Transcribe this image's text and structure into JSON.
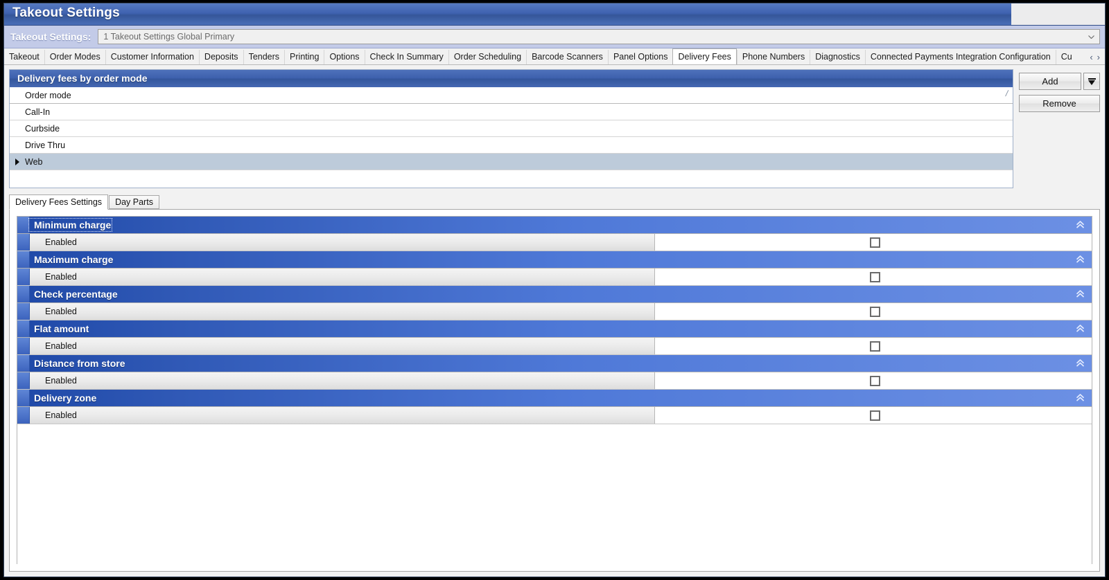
{
  "window": {
    "title": "Takeout Settings"
  },
  "selector": {
    "label": "Takeout Settings:",
    "value": "1 Takeout Settings Global Primary",
    "placeholder": "1 Takeout Settings Global Primary"
  },
  "main_tabs": [
    {
      "label": "Takeout",
      "active": false
    },
    {
      "label": "Order Modes",
      "active": false
    },
    {
      "label": "Customer Information",
      "active": false
    },
    {
      "label": "Deposits",
      "active": false
    },
    {
      "label": "Tenders",
      "active": false
    },
    {
      "label": "Printing",
      "active": false
    },
    {
      "label": "Options",
      "active": false
    },
    {
      "label": "Check In Summary",
      "active": false
    },
    {
      "label": "Order Scheduling",
      "active": false
    },
    {
      "label": "Barcode Scanners",
      "active": false
    },
    {
      "label": "Panel Options",
      "active": false
    },
    {
      "label": "Delivery Fees",
      "active": true
    },
    {
      "label": "Phone Numbers",
      "active": false
    },
    {
      "label": "Diagnostics",
      "active": false
    },
    {
      "label": "Connected Payments Integration Configuration",
      "active": false
    },
    {
      "label": "Cu",
      "active": false
    }
  ],
  "tab_nav": {
    "prev": "‹",
    "next": "›"
  },
  "grid": {
    "caption": "Delivery fees by order mode",
    "column_header": "Order mode",
    "sort_mark": "/",
    "rows": [
      {
        "label": "Call-In",
        "selected": false
      },
      {
        "label": "Curbside",
        "selected": false
      },
      {
        "label": "Drive Thru",
        "selected": false
      },
      {
        "label": "Web",
        "selected": true
      }
    ]
  },
  "side_buttons": {
    "add_label": "Add",
    "add_dropdown_icon": "dropdown-arrow-icon",
    "remove_label": "Remove"
  },
  "inner_tabs": [
    {
      "label": "Delivery Fees Settings",
      "active": true
    },
    {
      "label": "Day Parts",
      "active": false
    }
  ],
  "sections": [
    {
      "title": "Minimum charge",
      "focused": true,
      "collapse_icon": "collapse-chevron-icon",
      "rows": [
        {
          "label": "Enabled",
          "checked": false
        }
      ]
    },
    {
      "title": "Maximum charge",
      "focused": false,
      "collapse_icon": "collapse-chevron-icon",
      "rows": [
        {
          "label": "Enabled",
          "checked": false
        }
      ]
    },
    {
      "title": "Check percentage",
      "focused": false,
      "collapse_icon": "collapse-chevron-icon",
      "rows": [
        {
          "label": "Enabled",
          "checked": false
        }
      ]
    },
    {
      "title": "Flat amount",
      "focused": false,
      "collapse_icon": "collapse-chevron-icon",
      "rows": [
        {
          "label": "Enabled",
          "checked": false
        }
      ]
    },
    {
      "title": "Distance from store",
      "focused": false,
      "collapse_icon": "collapse-chevron-icon",
      "rows": [
        {
          "label": "Enabled",
          "checked": false
        }
      ]
    },
    {
      "title": "Delivery zone",
      "focused": false,
      "collapse_icon": "collapse-chevron-icon",
      "rows": [
        {
          "label": "Enabled",
          "checked": false
        }
      ]
    }
  ],
  "colors": {
    "title_blue": "#3f62b0",
    "selector_bar": "#c3cbe8",
    "section_header_left": "#1f49a8",
    "section_header_right": "#6c90e4",
    "row_selected": "#bdcbda",
    "accent_stripe": "#3c63bd"
  }
}
